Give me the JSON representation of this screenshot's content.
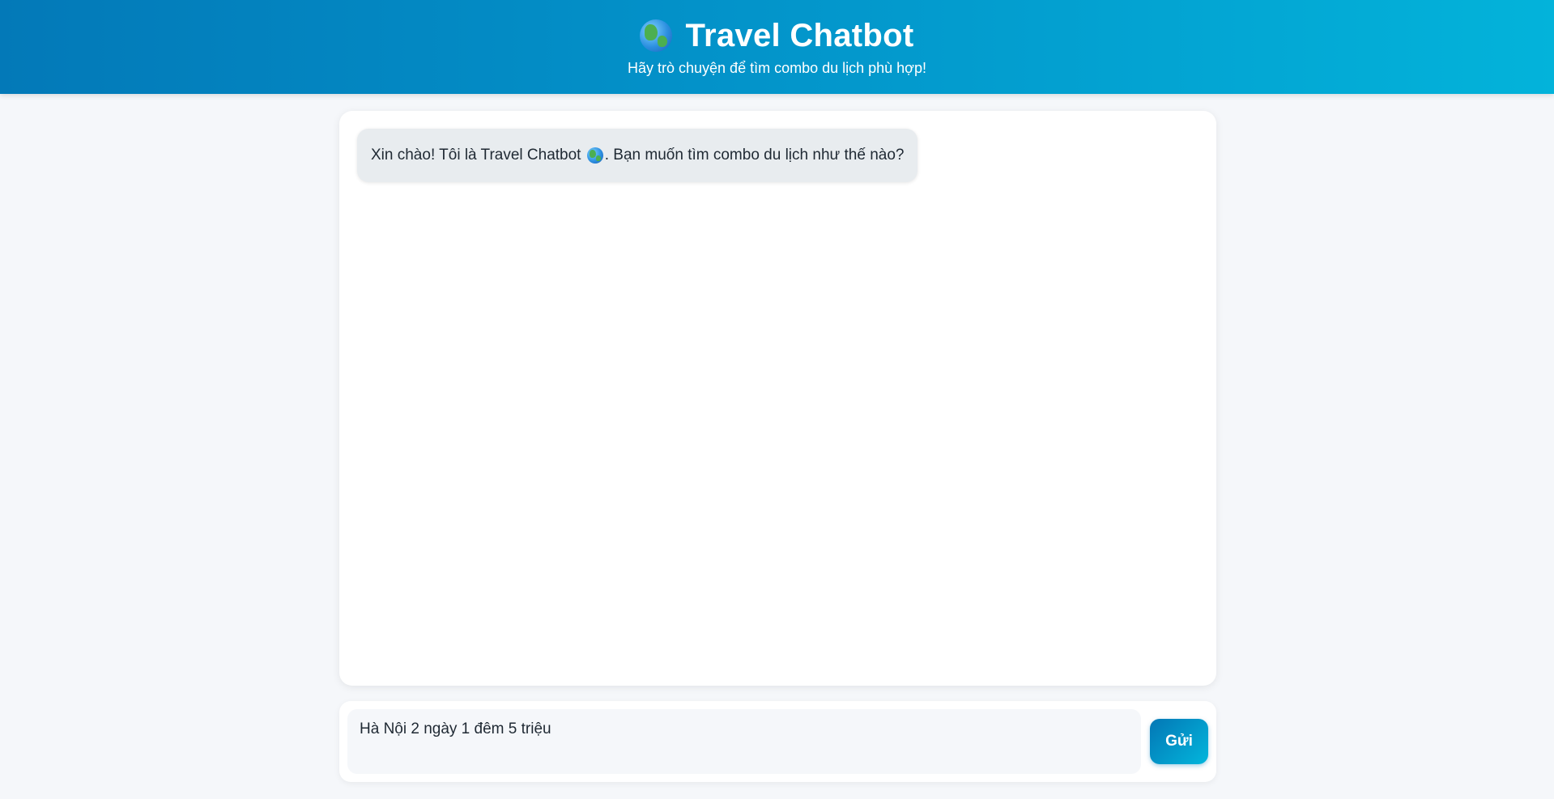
{
  "header": {
    "icon": "globe-emoji-icon",
    "title": "Travel Chatbot",
    "subtitle": "Hãy trò chuyện để tìm combo du lịch phù hợp!",
    "gradient_start": "#0379b8",
    "gradient_end": "#03b3da"
  },
  "chat": {
    "messages": [
      {
        "sender": "bot",
        "text_before_icon": "Xin chào! Tôi là Travel Chatbot",
        "icon": "globe-emoji-icon",
        "text_after_icon": ". Bạn muốn tìm combo du lịch như thế nào?"
      }
    ]
  },
  "composer": {
    "input_value": "Hà Nội 2 ngày 1 đêm 5 triệu",
    "send_label": "Gửi",
    "send_color": "#0392c9"
  }
}
